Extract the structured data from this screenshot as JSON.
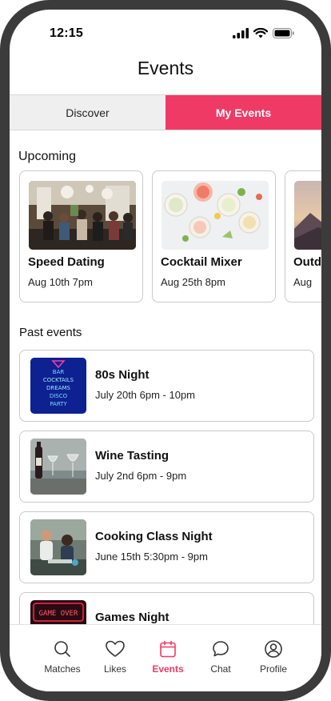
{
  "status_bar": {
    "time": "12:15"
  },
  "header": {
    "title": "Events"
  },
  "tabs": [
    {
      "label": "Discover",
      "active": false
    },
    {
      "label": "My Events",
      "active": true
    }
  ],
  "accent_color": "#ef3a66",
  "upcoming": {
    "label": "Upcoming",
    "events": [
      {
        "name": "Speed Dating",
        "date": "Aug 10th 7pm",
        "image": "bar-crowd-photo"
      },
      {
        "name": "Cocktail Mixer",
        "date": "Aug 25th 8pm",
        "image": "cocktails-photo"
      },
      {
        "name": "Outdoor",
        "date": "Aug",
        "image": "sunset-mountains-photo"
      }
    ]
  },
  "past": {
    "label": "Past events",
    "events": [
      {
        "name": "80s Night",
        "date": "July 20th 6pm - 10pm",
        "image": "neon-sign-photo"
      },
      {
        "name": "Wine Tasting",
        "date": "July 2nd 6pm - 9pm",
        "image": "wine-glasses-photo"
      },
      {
        "name": "Cooking Class Night",
        "date": "June 15th 5:30pm - 9pm",
        "image": "cooking-couple-photo"
      },
      {
        "name": "Games Night",
        "date": "",
        "image": "game-over-neon-photo"
      }
    ]
  },
  "nav": [
    {
      "label": "Matches",
      "icon": "search-icon",
      "active": false
    },
    {
      "label": "Likes",
      "icon": "heart-icon",
      "active": false
    },
    {
      "label": "Events",
      "icon": "calendar-icon",
      "active": true
    },
    {
      "label": "Chat",
      "icon": "chat-bubble-icon",
      "active": false
    },
    {
      "label": "Profile",
      "icon": "user-icon",
      "active": false
    }
  ]
}
